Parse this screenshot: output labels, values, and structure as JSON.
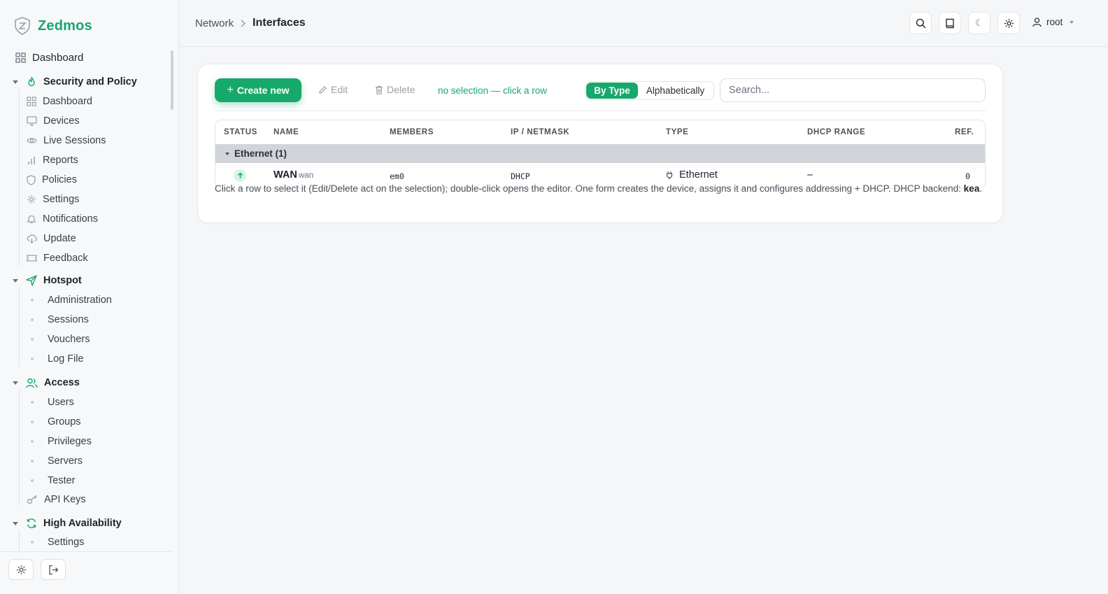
{
  "app": {
    "name": "Zedmos"
  },
  "sidebar": {
    "top": {
      "label": "Dashboard"
    },
    "sections": [
      {
        "title": "Security and Policy",
        "items": [
          "Dashboard",
          "Devices",
          "Live Sessions",
          "Reports",
          "Policies",
          "Settings",
          "Notifications",
          "Update",
          "Feedback"
        ]
      },
      {
        "title": "Hotspot",
        "items": [
          "Administration",
          "Sessions",
          "Vouchers",
          "Log File"
        ]
      },
      {
        "title": "Access",
        "items": [
          "Users",
          "Groups",
          "Privileges",
          "Servers",
          "Tester",
          "API Keys"
        ]
      },
      {
        "title": "High Availability",
        "items": [
          "Settings"
        ]
      }
    ]
  },
  "header": {
    "breadcrumb": [
      "Network",
      "Interfaces"
    ],
    "user": "root"
  },
  "toolbar": {
    "create_label": "Create new",
    "edit_label": "Edit",
    "delete_label": "Delete",
    "selection_hint": "no selection — click a row",
    "sort_by_type": "By Type",
    "sort_alpha": "Alphabetically",
    "search_placeholder": "Search..."
  },
  "table": {
    "columns": [
      "STATUS",
      "NAME",
      "MEMBERS",
      "IP / NETMASK",
      "TYPE",
      "DHCP RANGE",
      "REF."
    ],
    "group": {
      "label": "Ethernet (1)"
    },
    "rows": [
      {
        "name": "WAN",
        "ident": "wan",
        "members": "em0",
        "ip": "DHCP",
        "type": "Ethernet",
        "dhcp_range": "–",
        "ref": "0",
        "status": "up"
      }
    ]
  },
  "footnote": {
    "text": "Click a row to select it (Edit/Delete act on the selection); double-click opens the editor. One form creates the device, assigns it and configures addressing + DHCP. DHCP backend: ",
    "backend": "kea"
  },
  "colors": {
    "accent": "#17a86b",
    "group_row": "#d1d4d9"
  }
}
